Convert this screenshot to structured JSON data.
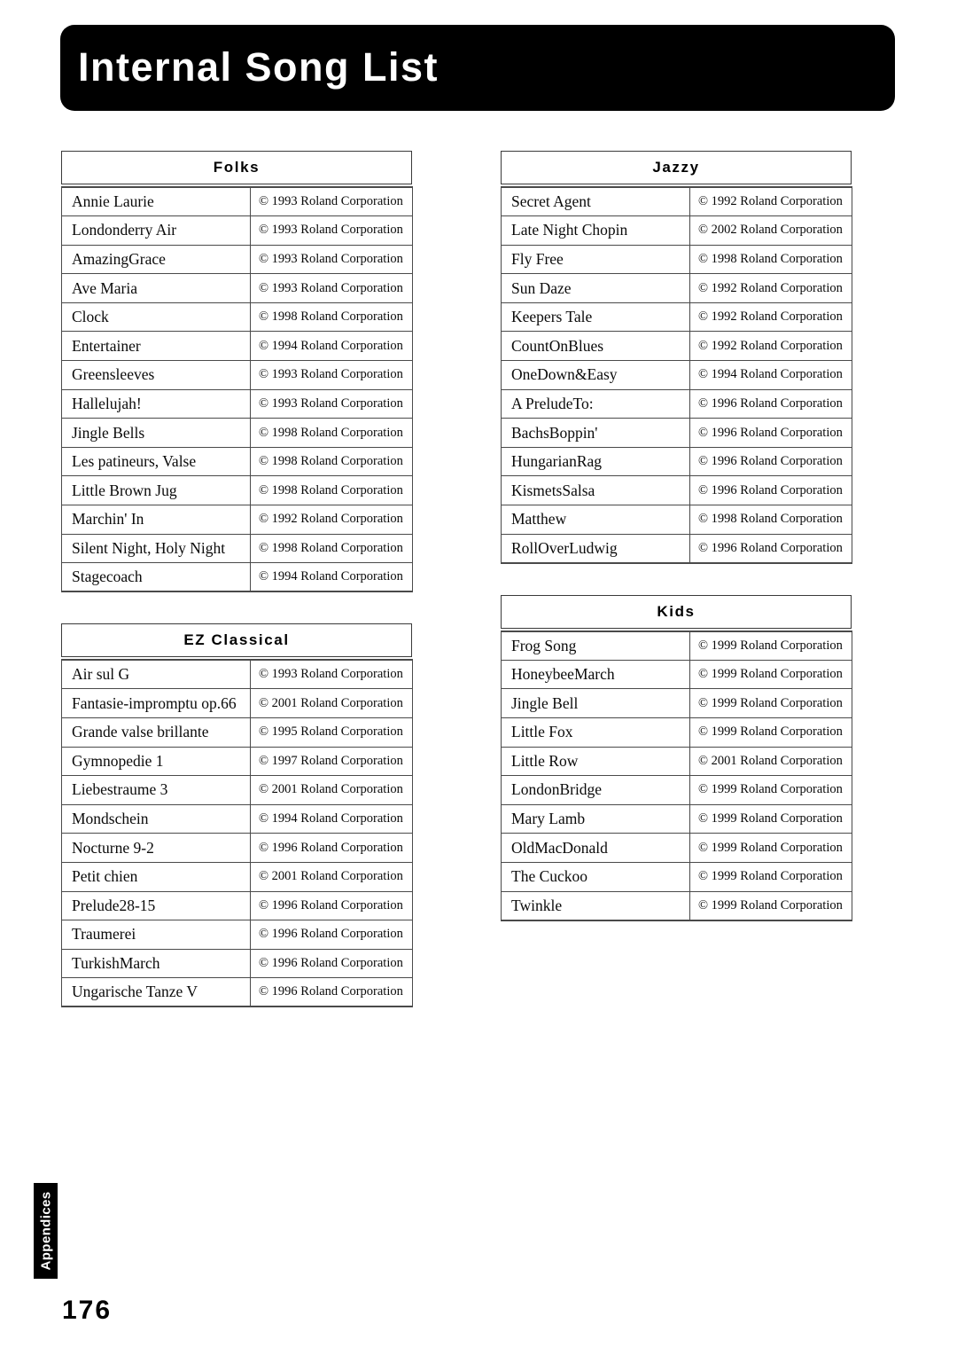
{
  "page": {
    "title": "Internal Song List",
    "number": "176",
    "side_tab": "Appendices"
  },
  "copyright_prefix": "©",
  "copyright_suffix": "Roland Corporation",
  "columns": {
    "left": [
      {
        "name": "Folks",
        "rows": [
          {
            "title": "Annie Laurie",
            "copyright": "© 1993 Roland Corporation"
          },
          {
            "title": "Londonderry Air",
            "copyright": "© 1993 Roland Corporation"
          },
          {
            "title": "AmazingGrace",
            "copyright": "© 1993 Roland Corporation"
          },
          {
            "title": "Ave Maria",
            "copyright": "© 1993 Roland Corporation"
          },
          {
            "title": "Clock",
            "copyright": "© 1998 Roland Corporation"
          },
          {
            "title": "Entertainer",
            "copyright": "© 1994 Roland Corporation"
          },
          {
            "title": "Greensleeves",
            "copyright": "© 1993 Roland Corporation"
          },
          {
            "title": "Hallelujah!",
            "copyright": "© 1993 Roland Corporation"
          },
          {
            "title": "Jingle Bells",
            "copyright": "© 1998 Roland Corporation"
          },
          {
            "title": "Les patineurs, Valse",
            "copyright": "© 1998 Roland Corporation"
          },
          {
            "title": "Little Brown Jug",
            "copyright": "© 1998 Roland Corporation"
          },
          {
            "title": "Marchin' In",
            "copyright": "© 1992 Roland Corporation"
          },
          {
            "title": "Silent Night, Holy Night",
            "copyright": "© 1998 Roland Corporation"
          },
          {
            "title": "Stagecoach",
            "copyright": "© 1994 Roland Corporation"
          }
        ]
      },
      {
        "name": "EZ Classical",
        "rows": [
          {
            "title": "Air sul G",
            "copyright": "© 1993 Roland Corporation"
          },
          {
            "title": "Fantasie-impromptu op.66",
            "copyright": "© 2001 Roland Corporation"
          },
          {
            "title": "Grande valse brillante",
            "copyright": "© 1995 Roland Corporation"
          },
          {
            "title": "Gymnopedie 1",
            "copyright": "© 1997 Roland Corporation"
          },
          {
            "title": "Liebestraume 3",
            "copyright": "© 2001 Roland Corporation"
          },
          {
            "title": "Mondschein",
            "copyright": "© 1994 Roland Corporation"
          },
          {
            "title": "Nocturne 9-2",
            "copyright": "© 1996 Roland Corporation"
          },
          {
            "title": "Petit chien",
            "copyright": "© 2001 Roland Corporation"
          },
          {
            "title": "Prelude28-15",
            "copyright": "© 1996 Roland Corporation"
          },
          {
            "title": "Traumerei",
            "copyright": "© 1996 Roland Corporation"
          },
          {
            "title": "TurkishMarch",
            "copyright": "© 1996 Roland Corporation"
          },
          {
            "title": "Ungarische Tanze V",
            "copyright": "© 1996 Roland Corporation"
          }
        ]
      }
    ],
    "right": [
      {
        "name": "Jazzy",
        "rows": [
          {
            "title": "Secret Agent",
            "copyright": "© 1992 Roland Corporation"
          },
          {
            "title": "Late Night Chopin",
            "copyright": "© 2002 Roland Corporation"
          },
          {
            "title": "Fly Free",
            "copyright": "© 1998 Roland Corporation"
          },
          {
            "title": "Sun Daze",
            "copyright": "© 1992 Roland Corporation"
          },
          {
            "title": "Keepers Tale",
            "copyright": "© 1992 Roland Corporation"
          },
          {
            "title": "CountOnBlues",
            "copyright": "© 1992 Roland Corporation"
          },
          {
            "title": "OneDown&Easy",
            "copyright": "© 1994 Roland Corporation"
          },
          {
            "title": "A PreludeTo:",
            "copyright": "© 1996 Roland Corporation"
          },
          {
            "title": "BachsBoppin'",
            "copyright": "© 1996 Roland Corporation"
          },
          {
            "title": "HungarianRag",
            "copyright": "© 1996 Roland Corporation"
          },
          {
            "title": "KismetsSalsa",
            "copyright": "© 1996 Roland Corporation"
          },
          {
            "title": "Matthew",
            "copyright": "© 1998 Roland Corporation"
          },
          {
            "title": "RollOverLudwig",
            "copyright": "© 1996 Roland Corporation"
          }
        ]
      },
      {
        "name": "Kids",
        "rows": [
          {
            "title": "Frog Song",
            "copyright": "© 1999 Roland Corporation"
          },
          {
            "title": "HoneybeeMarch",
            "copyright": "© 1999 Roland Corporation"
          },
          {
            "title": "Jingle Bell",
            "copyright": "© 1999 Roland Corporation"
          },
          {
            "title": "Little Fox",
            "copyright": "© 1999 Roland Corporation"
          },
          {
            "title": "Little Row",
            "copyright": "© 2001 Roland Corporation"
          },
          {
            "title": "LondonBridge",
            "copyright": "© 1999 Roland Corporation"
          },
          {
            "title": "Mary Lamb",
            "copyright": "© 1999 Roland Corporation"
          },
          {
            "title": "OldMacDonald",
            "copyright": "© 1999 Roland Corporation"
          },
          {
            "title": "The Cuckoo",
            "copyright": "© 1999 Roland Corporation"
          },
          {
            "title": "Twinkle",
            "copyright": "© 1999 Roland Corporation"
          }
        ]
      }
    ]
  }
}
